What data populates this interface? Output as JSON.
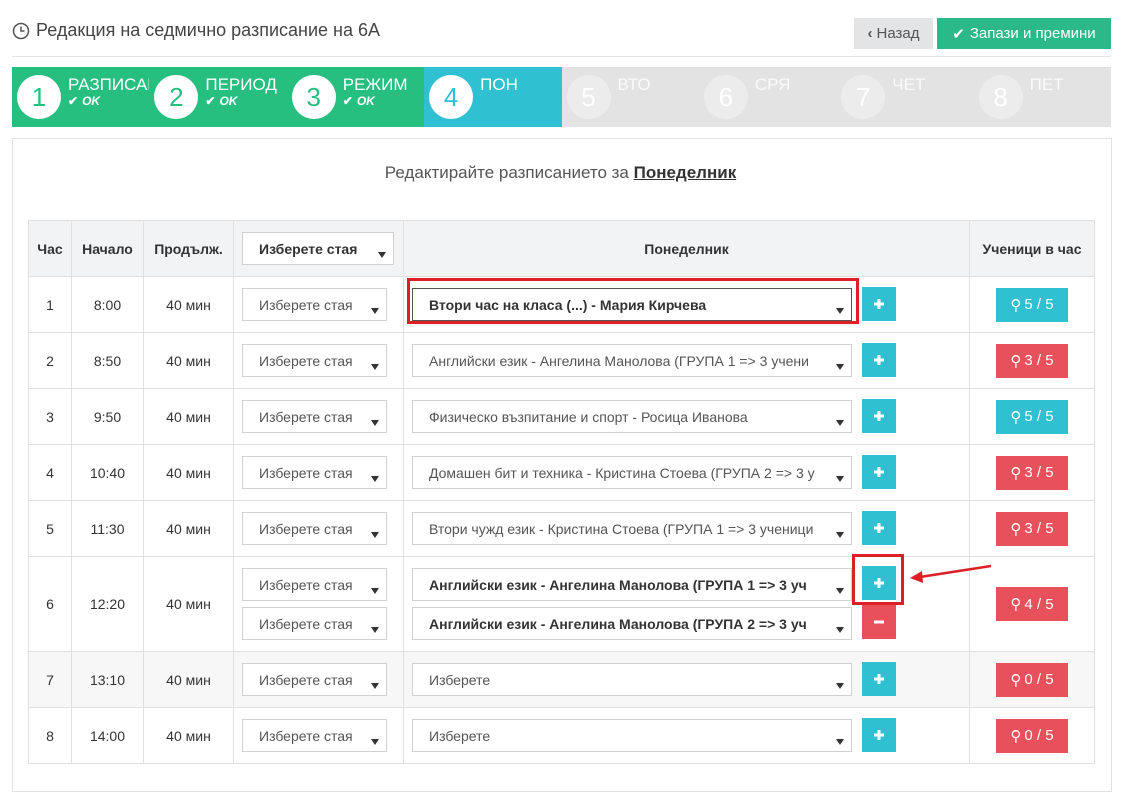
{
  "header": {
    "title": "Редакция на седмично разписание на 6А",
    "back_label": "Назад",
    "save_label": "Запази и премини"
  },
  "steps": [
    {
      "num": "1",
      "label": "РАЗПИСАН",
      "status": "OK",
      "state": "done"
    },
    {
      "num": "2",
      "label": "ПЕРИОД",
      "status": "OK",
      "state": "done"
    },
    {
      "num": "3",
      "label": "РЕЖИМ",
      "status": "OK",
      "state": "done"
    },
    {
      "num": "4",
      "label": "ПОН",
      "status": "",
      "state": "active"
    },
    {
      "num": "5",
      "label": "ВТО",
      "status": "",
      "state": "todo"
    },
    {
      "num": "6",
      "label": "СРЯ",
      "status": "",
      "state": "todo"
    },
    {
      "num": "7",
      "label": "ЧЕТ",
      "status": "",
      "state": "todo"
    },
    {
      "num": "8",
      "label": "ПЕТ",
      "status": "",
      "state": "todo"
    }
  ],
  "panel": {
    "prompt": "Редактирайте разписанието за",
    "day": "Понеделник"
  },
  "table": {
    "headers": {
      "hour": "Час",
      "start": "Начало",
      "duration": "Продълж.",
      "room_select": "Изберете стая",
      "day": "Понеделник",
      "students": "Ученици в час"
    },
    "rows": [
      {
        "hour": "1",
        "start": "8:00",
        "duration": "40 мин",
        "room": "Изберете стая",
        "subject": "Втори час на класа (...) - Мария Кирчева",
        "count": "5 / 5"
      },
      {
        "hour": "2",
        "start": "8:50",
        "duration": "40 мин",
        "room": "Изберете стая",
        "subject": "Английски език - Ангелина Манолова (ГРУПА 1 => 3 учени",
        "count": "3 / 5"
      },
      {
        "hour": "3",
        "start": "9:50",
        "duration": "40 мин",
        "room": "Изберете стая",
        "subject": "Физическо възпитание и спорт - Росица Иванова",
        "count": "5 / 5"
      },
      {
        "hour": "4",
        "start": "10:40",
        "duration": "40 мин",
        "room": "Изберете стая",
        "subject": "Домашен бит и техника - Кристина Стоева (ГРУПА 2 => 3 у",
        "count": "3 / 5"
      },
      {
        "hour": "5",
        "start": "11:30",
        "duration": "40 мин",
        "room": "Изберете стая",
        "subject": "Втори чужд език - Кристина Стоева (ГРУПА 1 => 3 ученици",
        "count": "3 / 5"
      },
      {
        "hour": "6",
        "start": "12:20",
        "duration": "40 мин",
        "room": "Изберете стая",
        "room2": "Изберете стая",
        "subject": "Английски език - Ангелина Манолова (ГРУПА 1 => 3 уч",
        "subject2": "Английски език - Ангелина Манолова (ГРУПА 2 => 3 уч",
        "count": "4 / 5"
      },
      {
        "hour": "7",
        "start": "13:10",
        "duration": "40 мин",
        "room": "Изберете стая",
        "subject": "Изберете",
        "count": "0 / 5"
      },
      {
        "hour": "8",
        "start": "14:00",
        "duration": "40 мин",
        "room": "Изберете стая",
        "subject": "Изберете",
        "count": "0 / 5"
      }
    ]
  },
  "colors": {
    "done": "#26bf80",
    "active": "#2fc1d2",
    "todo": "#e3e3e3",
    "full": "#2fc1d2",
    "partial": "#e8505b",
    "highlight": "#dd1f26"
  }
}
